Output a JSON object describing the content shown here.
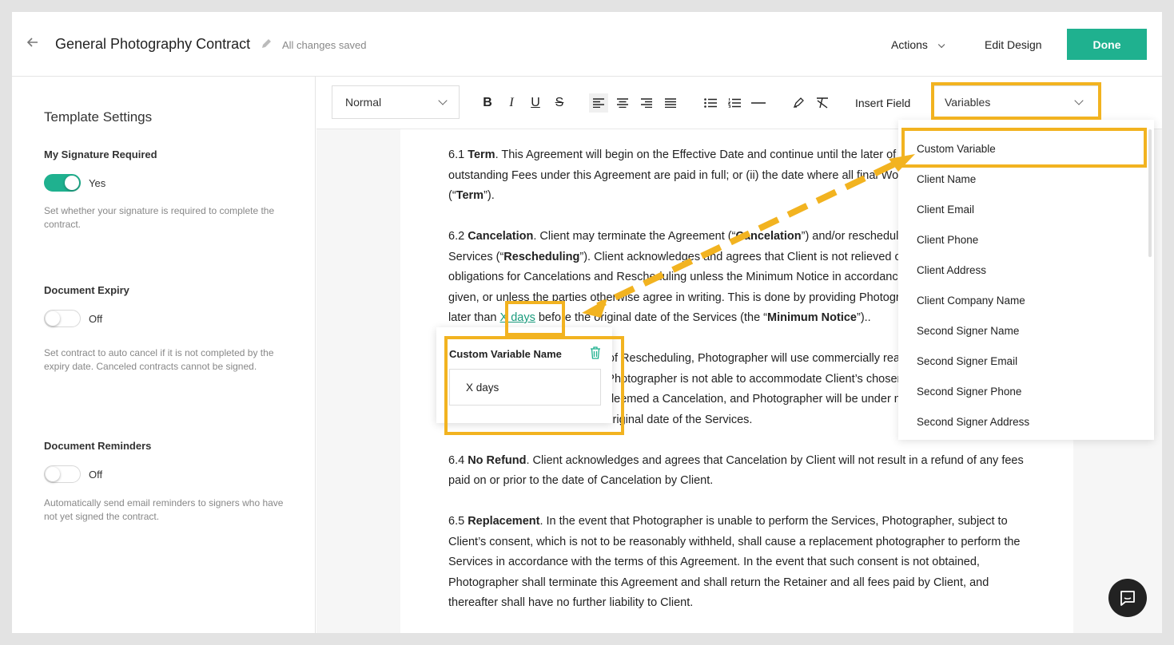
{
  "header": {
    "back_icon": "arrow-left-icon",
    "title": "General Photography Contract",
    "edit_icon": "pencil-icon",
    "status": "All changes saved",
    "actions_label": "Actions",
    "edit_design_label": "Edit Design",
    "done_label": "Done"
  },
  "sidebar": {
    "title": "Template Settings",
    "settings": [
      {
        "label": "My Signature Required",
        "state": "Yes",
        "on": true,
        "help": "Set whether your signature is required to complete the contract."
      },
      {
        "label": "Document Expiry",
        "state": "Off",
        "on": false,
        "help": "Set contract to auto cancel if it is not completed by the expiry date. Canceled contracts cannot be signed."
      },
      {
        "label": "Document Reminders",
        "state": "Off",
        "on": false,
        "help": "Automatically send email reminders to signers who have not yet signed the contract."
      }
    ]
  },
  "toolbar": {
    "style_value": "Normal",
    "insert_field_label": "Insert Field",
    "variables_label": "Variables",
    "buttons": [
      "bold",
      "italic",
      "underline",
      "strikethrough",
      "align-left",
      "align-center",
      "align-right",
      "align-justify",
      "bullet-list",
      "numbered-list",
      "horizontal-rule",
      "highlight",
      "clear-format"
    ]
  },
  "dropdown": {
    "items": [
      "Custom Variable",
      "Client Name",
      "Client Email",
      "Client Phone",
      "Client Address",
      "Client Company Name",
      "Second Signer Name",
      "Second Signer Email",
      "Second Signer Phone",
      "Second Signer Address"
    ]
  },
  "popup": {
    "title": "Custom Variable Name",
    "value": "X days",
    "delete_icon": "trash-icon"
  },
  "doc": {
    "p1_num": "6.1 ",
    "p1_head": "Term",
    "p1_text": ". This Agreement will begin on the Effective Date and continue until the later of (i) the date all outstanding Fees under this Agreement are paid in full; or (ii) the date where all final Work Product is delivered (“",
    "p1_term": "Term",
    "p1_end": "”).",
    "p2_num": "6.2 ",
    "p2_head": "Cancelation",
    "p2_a": ". Client may terminate the Agreement (“",
    "p2_cancel": "Cancelation",
    "p2_b": "”) and/or reschedule the date of the Services (“",
    "p2_resched": "Rescheduling",
    "p2_c": "”). Client acknowledges and agrees that Client is not relieved of any payment obligations for Cancelations and Rescheduling unless the Minimum Notice in accordance with this Agreement is given, or unless the parties otherwise agree in writing. This is done by providing Photographer written notice no later than ",
    "p2_var": "X days",
    "p2_d": " before the original date of the Services (the “",
    "p2_min": "Minimum Notice",
    "p2_e": "”)..",
    "p3_text": "6.3 Rescheduling. In the event of Rescheduling, Photographer will use commercially reasonable efforts to accommodate the new date. If Photographer is not able to accommodate Client’s chosen date, the parties agree that such Rescheduling will be deemed a Cancelation, and Photographer will be under no obligation to perform the Services other than on the original date of the Services.",
    "p4_num": "6.4 ",
    "p4_head": "No Refund",
    "p4_text": ". Client acknowledges and agrees that Cancelation by Client will not result in a refund of any fees paid on or prior to the date of Cancelation by Client.",
    "p5_num": "6.5 ",
    "p5_head": "Replacement",
    "p5_text": ". In the event that Photographer is unable to perform the Services, Photographer, subject to Client’s consent, which is not to be reasonably withheld, shall cause a replacement photographer to perform the Services in accordance with the terms of this Agreement. In the event that such consent is not obtained, Photographer shall terminate this Agreement and shall return the Retainer and all fees paid by Client, and thereafter shall have no further liability to Client."
  },
  "colors": {
    "accent": "#1fb18f",
    "highlight": "#f2b320"
  },
  "chat_icon": "chat-bubble-icon"
}
